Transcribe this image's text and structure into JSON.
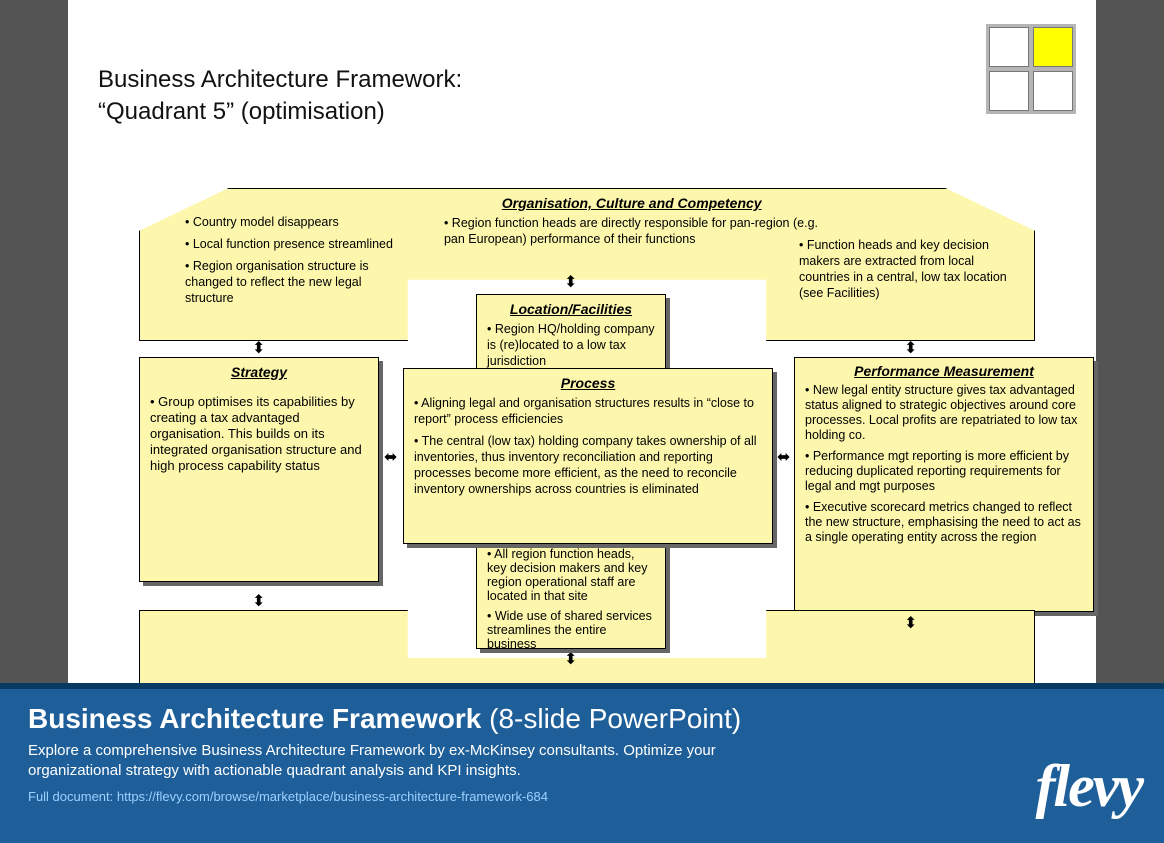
{
  "title_line1": "Business Architecture Framework:",
  "title_line2": "“Quadrant 5” (optimisation)",
  "org": {
    "header": "Organisation, Culture and Competency",
    "center": "• Region function heads are directly responsible for pan-region (e.g. pan European) performance of their functions",
    "left1": "• Country model disappears",
    "left2": "• Local function presence streamlined",
    "left3": "• Region organisation structure is changed to reflect the new legal structure",
    "right": "• Function heads and key decision makers are extracted from local countries in a central, low tax location (see Facilities)"
  },
  "strategy": {
    "header": "Strategy",
    "body": "• Group optimises its capabilities by creating a tax advantaged organisation. This builds on its integrated organisation structure and high process capability status"
  },
  "location": {
    "header": "Location/Facilities",
    "top": "• Region HQ/holding company is (re)located to a low tax jurisdiction",
    "bot1": "• All region function heads, key decision makers and key region operational staff are located in that site",
    "bot2": "• Wide use of shared services streamlines the entire business"
  },
  "process": {
    "header": "Process",
    "p1": "• Aligning legal and organisation structures results in “close to report” process efficiencies",
    "p2": "• The central (low tax) holding company takes ownership of all inventories, thus inventory reconciliation and reporting processes become more efficient, as the need to reconcile inventory ownerships across countries is eliminated"
  },
  "perf": {
    "header": "Performance Measurement",
    "p1": "• New legal entity structure gives tax advantaged status aligned to strategic objectives around core processes. Local profits are repatriated to low tax holding co.",
    "p2": "• Performance mgt reporting is more efficient by reducing duplicated reporting requirements for legal and mgt purposes",
    "p3": "• Executive scorecard metrics changed to reflect the new structure, emphasising the need to act as a single operating entity across the region"
  },
  "footer": {
    "title_bold": "Business Architecture Framework",
    "title_tail": " (8-slide PowerPoint)",
    "desc": "Explore a comprehensive Business Architecture Framework by ex-McKinsey consultants. Optimize your organizational strategy with actionable quadrant analysis and KPI insights.",
    "url": "Full document: https://flevy.com/browse/marketplace/business-architecture-framework-684",
    "logo": "flevy"
  }
}
